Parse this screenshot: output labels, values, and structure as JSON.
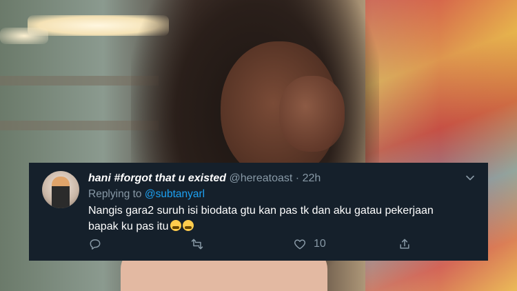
{
  "tweet": {
    "display_name": "hani #forgot that u existed",
    "handle": "@hereatoast",
    "separator": "·",
    "time": "22h",
    "replying_prefix": "Replying to",
    "replying_mention": "@subtanyarl",
    "text_line1": "Nangis gara2 suruh isi biodata gtu kan pas tk dan aku gatau pekerjaan",
    "text_line2": "bapak ku pas itu",
    "emojis": [
      "loudly-crying-face",
      "loudly-crying-face"
    ],
    "likes": "10"
  },
  "colors": {
    "card_bg": "#15202b",
    "secondary_text": "#8899a6",
    "mention": "#1da1f2"
  },
  "icons": [
    "chevron-down-icon",
    "reply-icon",
    "retweet-icon",
    "like-icon",
    "share-icon"
  ]
}
